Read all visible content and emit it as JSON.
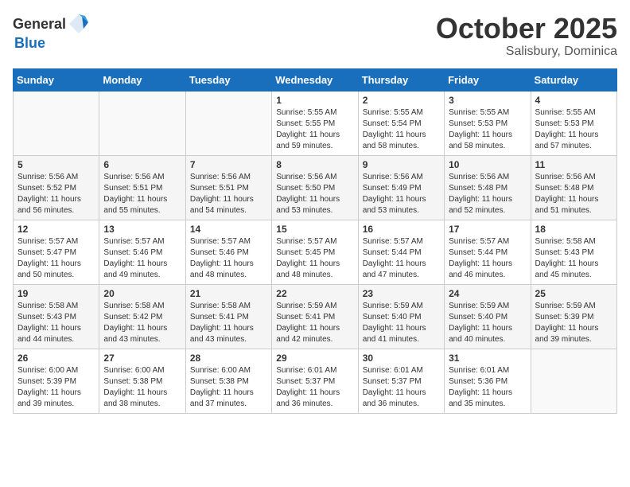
{
  "header": {
    "logo_general": "General",
    "logo_blue": "Blue",
    "month": "October 2025",
    "location": "Salisbury, Dominica"
  },
  "weekdays": [
    "Sunday",
    "Monday",
    "Tuesday",
    "Wednesday",
    "Thursday",
    "Friday",
    "Saturday"
  ],
  "weeks": [
    [
      {
        "day": "",
        "info": ""
      },
      {
        "day": "",
        "info": ""
      },
      {
        "day": "",
        "info": ""
      },
      {
        "day": "1",
        "info": "Sunrise: 5:55 AM\nSunset: 5:55 PM\nDaylight: 11 hours\nand 59 minutes."
      },
      {
        "day": "2",
        "info": "Sunrise: 5:55 AM\nSunset: 5:54 PM\nDaylight: 11 hours\nand 58 minutes."
      },
      {
        "day": "3",
        "info": "Sunrise: 5:55 AM\nSunset: 5:53 PM\nDaylight: 11 hours\nand 58 minutes."
      },
      {
        "day": "4",
        "info": "Sunrise: 5:55 AM\nSunset: 5:53 PM\nDaylight: 11 hours\nand 57 minutes."
      }
    ],
    [
      {
        "day": "5",
        "info": "Sunrise: 5:56 AM\nSunset: 5:52 PM\nDaylight: 11 hours\nand 56 minutes."
      },
      {
        "day": "6",
        "info": "Sunrise: 5:56 AM\nSunset: 5:51 PM\nDaylight: 11 hours\nand 55 minutes."
      },
      {
        "day": "7",
        "info": "Sunrise: 5:56 AM\nSunset: 5:51 PM\nDaylight: 11 hours\nand 54 minutes."
      },
      {
        "day": "8",
        "info": "Sunrise: 5:56 AM\nSunset: 5:50 PM\nDaylight: 11 hours\nand 53 minutes."
      },
      {
        "day": "9",
        "info": "Sunrise: 5:56 AM\nSunset: 5:49 PM\nDaylight: 11 hours\nand 53 minutes."
      },
      {
        "day": "10",
        "info": "Sunrise: 5:56 AM\nSunset: 5:48 PM\nDaylight: 11 hours\nand 52 minutes."
      },
      {
        "day": "11",
        "info": "Sunrise: 5:56 AM\nSunset: 5:48 PM\nDaylight: 11 hours\nand 51 minutes."
      }
    ],
    [
      {
        "day": "12",
        "info": "Sunrise: 5:57 AM\nSunset: 5:47 PM\nDaylight: 11 hours\nand 50 minutes."
      },
      {
        "day": "13",
        "info": "Sunrise: 5:57 AM\nSunset: 5:46 PM\nDaylight: 11 hours\nand 49 minutes."
      },
      {
        "day": "14",
        "info": "Sunrise: 5:57 AM\nSunset: 5:46 PM\nDaylight: 11 hours\nand 48 minutes."
      },
      {
        "day": "15",
        "info": "Sunrise: 5:57 AM\nSunset: 5:45 PM\nDaylight: 11 hours\nand 48 minutes."
      },
      {
        "day": "16",
        "info": "Sunrise: 5:57 AM\nSunset: 5:44 PM\nDaylight: 11 hours\nand 47 minutes."
      },
      {
        "day": "17",
        "info": "Sunrise: 5:57 AM\nSunset: 5:44 PM\nDaylight: 11 hours\nand 46 minutes."
      },
      {
        "day": "18",
        "info": "Sunrise: 5:58 AM\nSunset: 5:43 PM\nDaylight: 11 hours\nand 45 minutes."
      }
    ],
    [
      {
        "day": "19",
        "info": "Sunrise: 5:58 AM\nSunset: 5:43 PM\nDaylight: 11 hours\nand 44 minutes."
      },
      {
        "day": "20",
        "info": "Sunrise: 5:58 AM\nSunset: 5:42 PM\nDaylight: 11 hours\nand 43 minutes."
      },
      {
        "day": "21",
        "info": "Sunrise: 5:58 AM\nSunset: 5:41 PM\nDaylight: 11 hours\nand 43 minutes."
      },
      {
        "day": "22",
        "info": "Sunrise: 5:59 AM\nSunset: 5:41 PM\nDaylight: 11 hours\nand 42 minutes."
      },
      {
        "day": "23",
        "info": "Sunrise: 5:59 AM\nSunset: 5:40 PM\nDaylight: 11 hours\nand 41 minutes."
      },
      {
        "day": "24",
        "info": "Sunrise: 5:59 AM\nSunset: 5:40 PM\nDaylight: 11 hours\nand 40 minutes."
      },
      {
        "day": "25",
        "info": "Sunrise: 5:59 AM\nSunset: 5:39 PM\nDaylight: 11 hours\nand 39 minutes."
      }
    ],
    [
      {
        "day": "26",
        "info": "Sunrise: 6:00 AM\nSunset: 5:39 PM\nDaylight: 11 hours\nand 39 minutes."
      },
      {
        "day": "27",
        "info": "Sunrise: 6:00 AM\nSunset: 5:38 PM\nDaylight: 11 hours\nand 38 minutes."
      },
      {
        "day": "28",
        "info": "Sunrise: 6:00 AM\nSunset: 5:38 PM\nDaylight: 11 hours\nand 37 minutes."
      },
      {
        "day": "29",
        "info": "Sunrise: 6:01 AM\nSunset: 5:37 PM\nDaylight: 11 hours\nand 36 minutes."
      },
      {
        "day": "30",
        "info": "Sunrise: 6:01 AM\nSunset: 5:37 PM\nDaylight: 11 hours\nand 36 minutes."
      },
      {
        "day": "31",
        "info": "Sunrise: 6:01 AM\nSunset: 5:36 PM\nDaylight: 11 hours\nand 35 minutes."
      },
      {
        "day": "",
        "info": ""
      }
    ]
  ]
}
